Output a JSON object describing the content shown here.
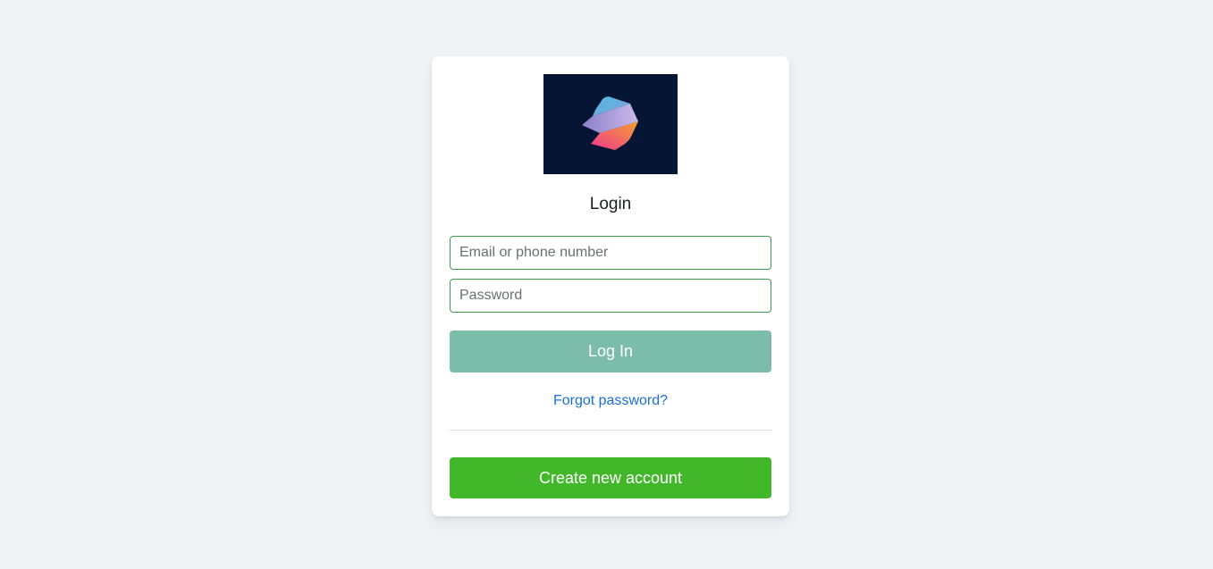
{
  "login_card": {
    "logo": {
      "icon": "brand-logo",
      "background_color": "#061534"
    },
    "title": "Login",
    "email_placeholder": "Email or phone number",
    "password_placeholder": "Password",
    "login_label": "Log In",
    "forgot_label": "Forgot password?",
    "create_label": "Create new account"
  },
  "colors": {
    "page_background": "#f0f2f5",
    "input_border": "#3f9b4f",
    "login_button": "#7bbda8",
    "link": "#1b6fd6",
    "create_button": "#42b72a"
  }
}
